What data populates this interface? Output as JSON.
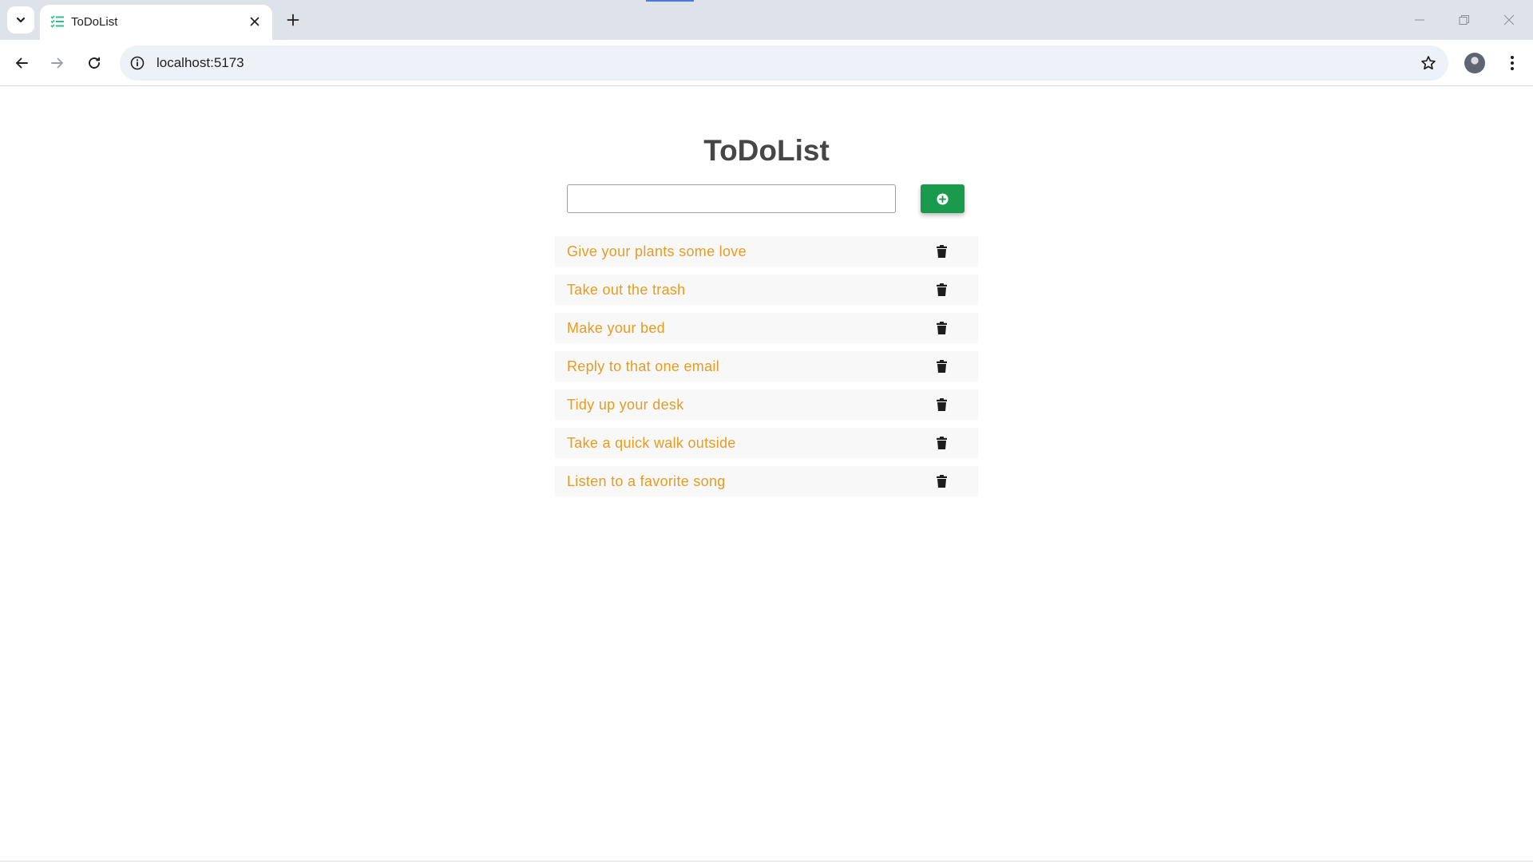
{
  "browser": {
    "tab": {
      "title": "ToDoList",
      "favicon": "checklist-icon"
    },
    "address_bar": {
      "url": "localhost:5173"
    }
  },
  "app": {
    "title": "ToDoList",
    "input": {
      "value": "",
      "placeholder": ""
    },
    "add_button": {
      "icon": "plus-circle-icon",
      "color": "#1a9a4c"
    },
    "todo_text_color": "#e69c24",
    "todos": [
      {
        "text": "Give your plants some love"
      },
      {
        "text": "Take out the trash"
      },
      {
        "text": "Make your bed"
      },
      {
        "text": "Reply to that one email"
      },
      {
        "text": "Tidy up your desk"
      },
      {
        "text": "Take a quick walk outside"
      },
      {
        "text": "Listen to a favorite song"
      }
    ]
  }
}
